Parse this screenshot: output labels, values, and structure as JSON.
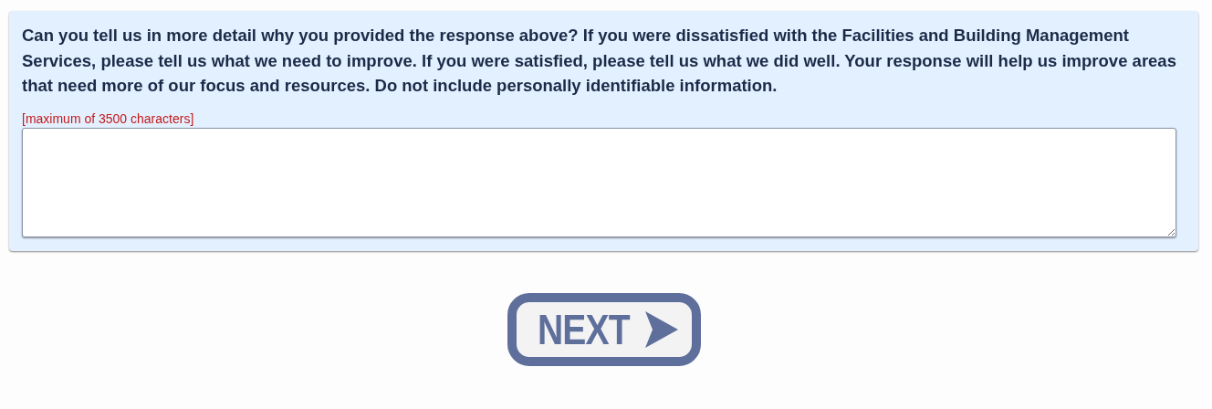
{
  "question": {
    "text": "Can you tell us in more detail why you provided the response above? If you were dissatisfied with the Facilities and Building Management Services, please tell us what we need to improve. If you were satisfied, please tell us what we did well. Your response will help us improve areas that need more of our focus and resources. Do not include personally identifiable information.",
    "limit_note": "[maximum of 3500 characters]"
  },
  "next_button": {
    "label": "NEXT"
  }
}
